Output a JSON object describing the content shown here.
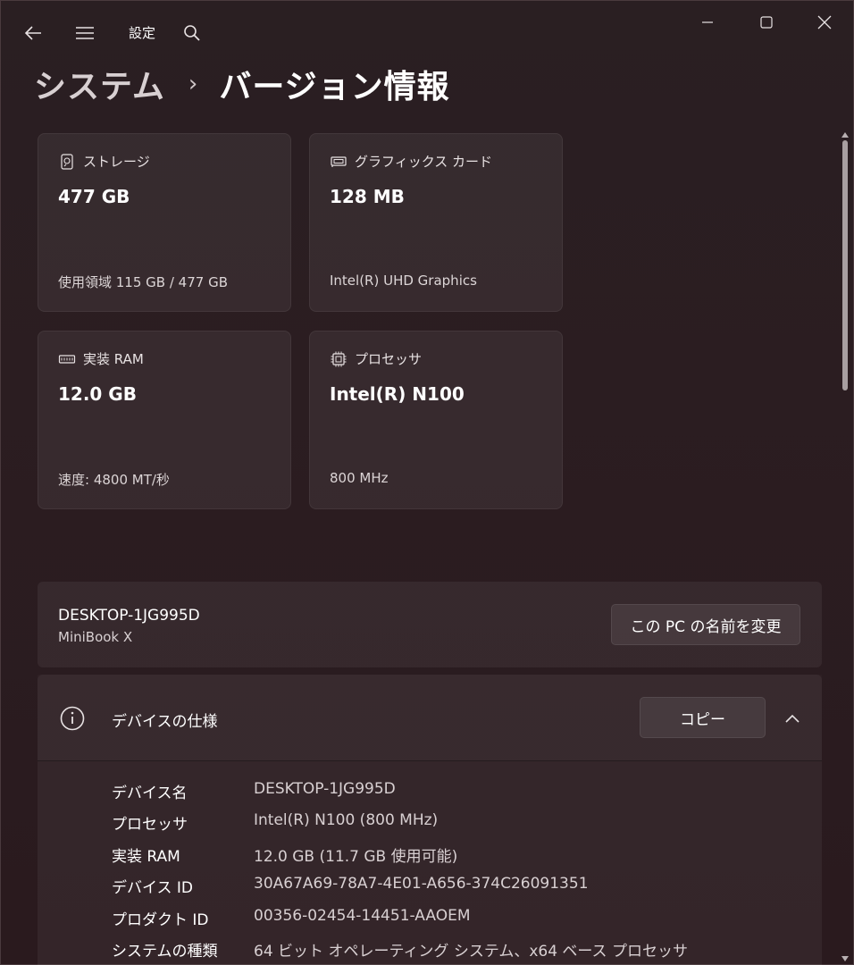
{
  "titlebar": {
    "app_name": "設定",
    "icons": {
      "back": "back-arrow-icon",
      "menu": "hamburger-menu-icon",
      "search": "search-icon",
      "minimize": "minimize-icon",
      "maximize": "maximize-icon",
      "close": "close-icon"
    }
  },
  "breadcrumb": {
    "parent": "システム",
    "separator": "›",
    "current": "バージョン情報"
  },
  "cards": [
    {
      "title": "ストレージ",
      "icon": "hard-drive-icon",
      "value": "477 GB",
      "sub": "使用領域 115 GB / 477 GB"
    },
    {
      "title": "グラフィックス カード",
      "icon": "graphics-card-icon",
      "value": "128 MB",
      "sub": "Intel(R) UHD Graphics"
    },
    {
      "title": "実装 RAM",
      "icon": "memory-icon",
      "value": "12.0 GB",
      "sub": "速度: 4800 MT/秒"
    },
    {
      "title": "プロセッサ",
      "icon": "processor-icon",
      "value": "Intel(R) N100",
      "sub": "800 MHz"
    }
  ],
  "pc": {
    "name": "DESKTOP-1JG995D",
    "model": "MiniBook X",
    "rename_label": "この PC の名前を変更"
  },
  "specs": {
    "title": "デバイスの仕様",
    "copy_label": "コピー",
    "rows": [
      {
        "label": "デバイス名",
        "value": "DESKTOP-1JG995D"
      },
      {
        "label": "プロセッサ",
        "value": "Intel(R) N100 (800 MHz)"
      },
      {
        "label": "実装 RAM",
        "value": "12.0 GB (11.7 GB 使用可能)"
      },
      {
        "label": "デバイス ID",
        "value": "30A67A69-78A7-4E01-A656-374C26091351"
      },
      {
        "label": "プロダクト ID",
        "value": "00356-02454-14451-AAOEM"
      },
      {
        "label": "システムの種類",
        "value": "64 ビット オペレーティング システム、x64 ベース プロセッサ"
      }
    ]
  },
  "colors": {
    "background": "#2a1f22",
    "card": "#3a2e31",
    "text": "#ffffff",
    "muted": "#d8d0d2"
  }
}
